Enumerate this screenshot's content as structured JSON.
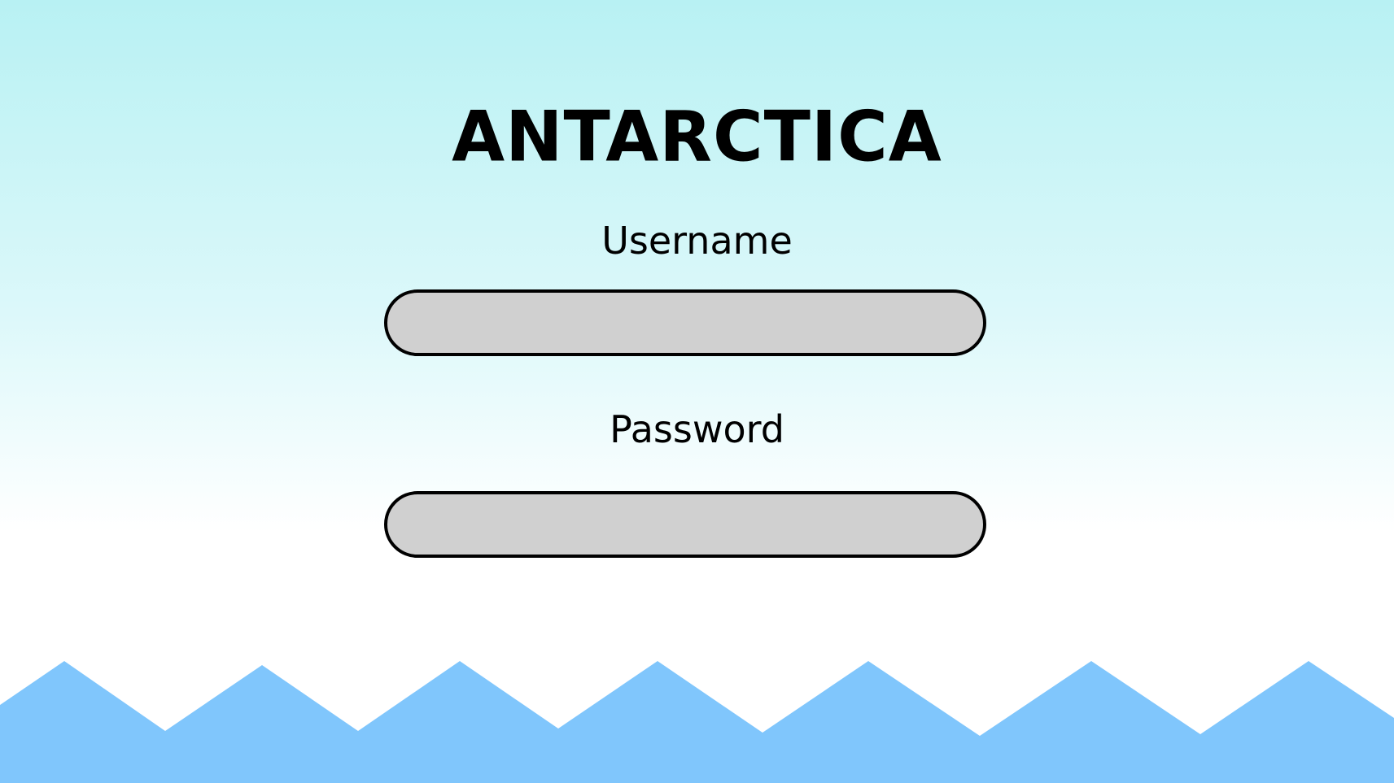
{
  "app": {
    "title": "ANTARCTICA"
  },
  "login_form": {
    "username_label": "Username",
    "username_value": "",
    "password_label": "Password",
    "password_value": ""
  },
  "colors": {
    "sky_top": "#b8f1f3",
    "sky_bottom": "#ffffff",
    "field_fill": "#d0d0d0",
    "field_border": "#000000",
    "mountains": "#80c6fc"
  }
}
